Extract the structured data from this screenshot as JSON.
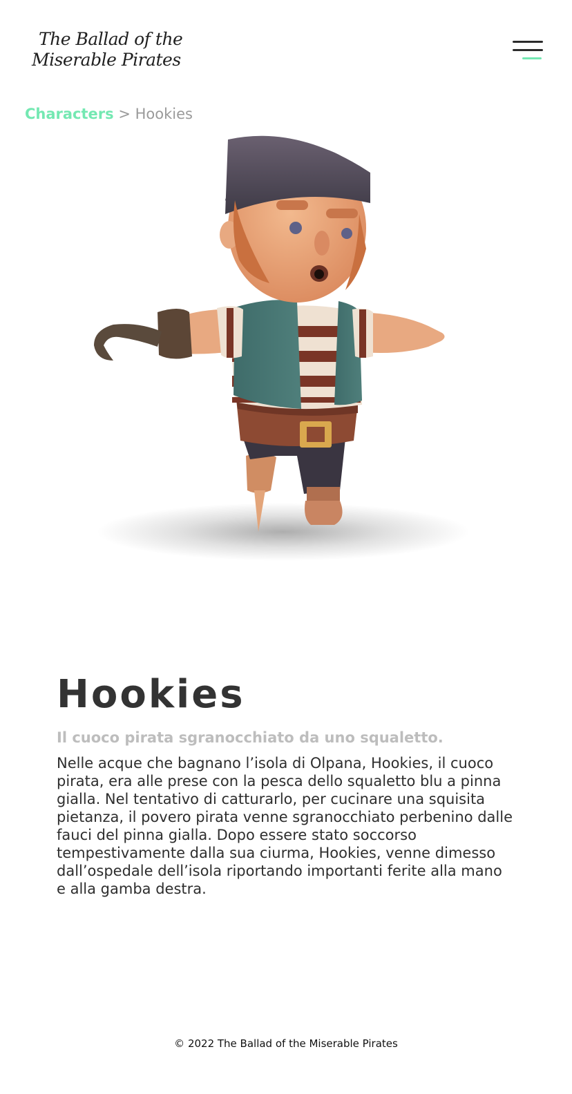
{
  "header": {
    "logo_line1": "The Ballad of the",
    "logo_line2": "Miserable Pirates"
  },
  "breadcrumb": {
    "parent": "Characters",
    "separator": " > ",
    "current": "Hookies"
  },
  "character": {
    "name": "Hookies",
    "tagline": "Il cuoco pirata sgranocchiato da uno squaletto.",
    "description": "Nelle acque che bagnano l’isola di Olpana, Hookies, il cuoco pirata, era alle prese con la pesca dello squaletto blu a pinna gialla. Nel tentativo di catturarlo, per cucinare una squisita pietanza, il povero pirata venne sgranocchiato perbenino dalle fauci del pinna gialla. Dopo essere stato soccorso tempestivamente dalla sua ciurma, Hookies, venne dimesso dall’ospedale dell’isola riportando importanti ferite alla mano e alla gamba destra."
  },
  "footer": {
    "copyright": "© 2022 The Ballad of the Miserable Pirates"
  },
  "colors": {
    "accent": "#74e8b2",
    "text": "#2e2e2e",
    "muted": "#bdbdbd"
  },
  "icons": {
    "menu": "hamburger-menu-icon"
  }
}
